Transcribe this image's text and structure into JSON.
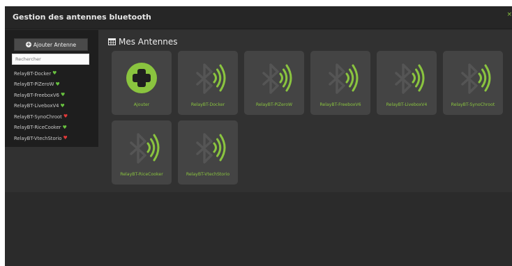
{
  "window": {
    "title": "Gestion des antennes bluetooth",
    "close_glyph": "×"
  },
  "sidebar": {
    "add_button_label": "Ajouter Antenne",
    "search_placeholder": "Rechercher",
    "antennas": [
      {
        "label": "RelayBT-Docker",
        "status": "ok"
      },
      {
        "label": "RelayBT-PiZeroW",
        "status": "ok"
      },
      {
        "label": "RelayBT-FreeboxV6",
        "status": "ok"
      },
      {
        "label": "RelayBT-LiveboxV4",
        "status": "ok"
      },
      {
        "label": "RelayBT-SynoChroot",
        "status": "ko"
      },
      {
        "label": "RelayBT-RiceCooker",
        "status": "ok"
      },
      {
        "label": "RelayBT-VtechStorio",
        "status": "ko"
      }
    ]
  },
  "main": {
    "section_title": "Mes Antennes",
    "add_tile_label": "Ajouter",
    "tiles": [
      {
        "label": "RelayBT-Docker"
      },
      {
        "label": "RelayBT-PiZeroW"
      },
      {
        "label": "RelayBT-FreeboxV6"
      },
      {
        "label": "RelayBT-LiveboxV4"
      },
      {
        "label": "RelayBT-SynoChroot"
      },
      {
        "label": "RelayBT-RiceCooker"
      },
      {
        "label": "RelayBT-VtechStorio"
      }
    ]
  },
  "colors": {
    "accent": "#8ac43f",
    "status_ok": "#68c23f",
    "status_ko": "#e23838",
    "tile_bg": "#444444",
    "sidebar_bg": "#1e1e1e"
  }
}
